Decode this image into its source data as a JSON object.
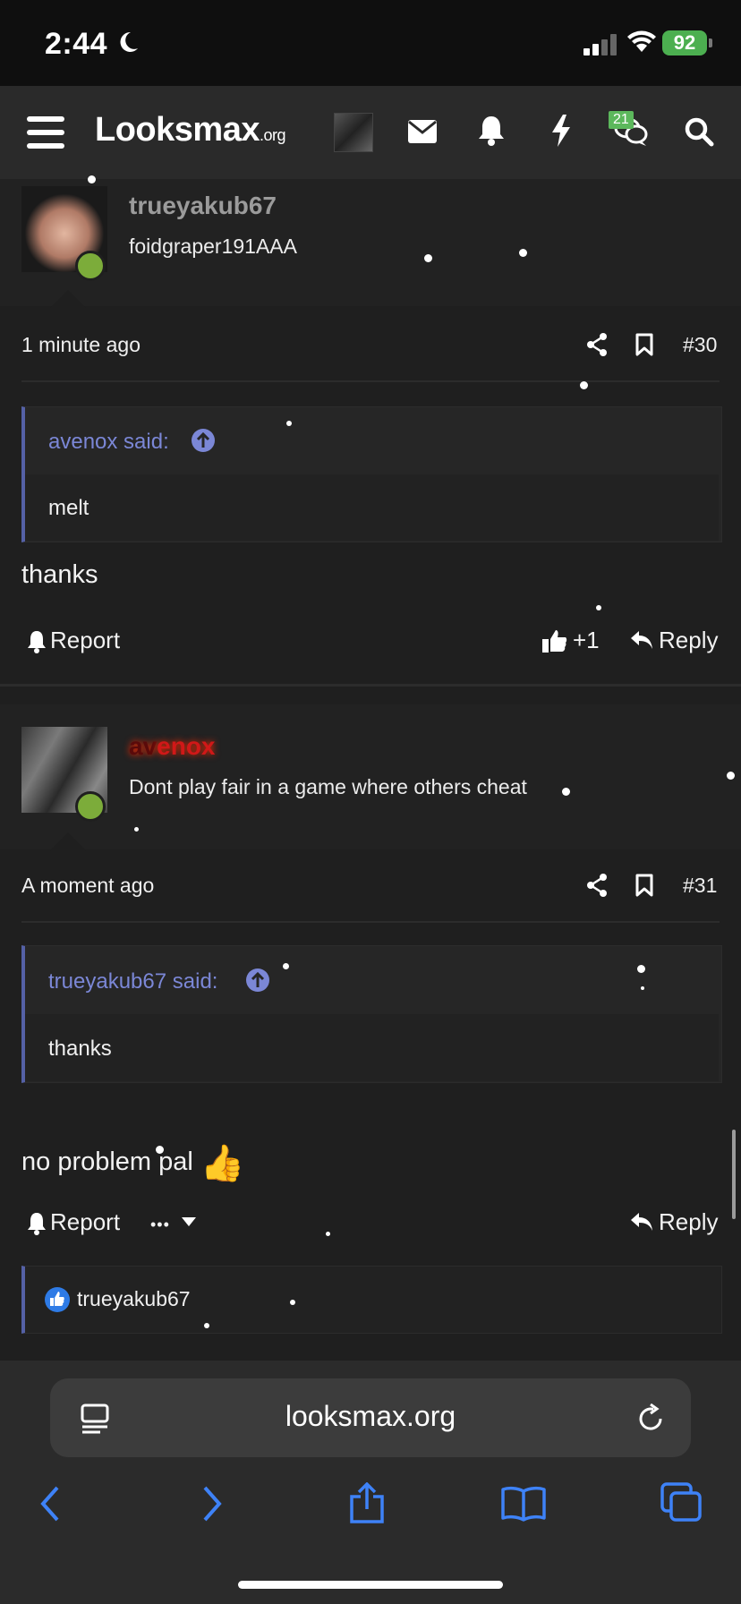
{
  "status": {
    "time": "2:44",
    "battery": "92"
  },
  "header": {
    "logo_main": "Looksmax",
    "logo_suffix": ".org",
    "chat_badge": "21"
  },
  "posts": [
    {
      "username": "trueyakub67",
      "user_title": "foidgraper191AAA",
      "time": "1 minute ago",
      "number": "#30",
      "quote_author": "avenox said:",
      "quote_text": "melt",
      "text": "thanks",
      "report_label": "Report",
      "like_count": "+1",
      "reply_label": "Reply"
    },
    {
      "username_part1": "av",
      "username_part2": "enox",
      "user_title": "Dont play fair in a game where others cheat",
      "time": "A moment ago",
      "number": "#31",
      "quote_author": "trueyakub67 said:",
      "quote_text": "thanks",
      "text": "no problem pal",
      "emoji": "👍",
      "report_label": "Report",
      "more_label": "•••",
      "reply_label": "Reply",
      "reaction_user": "trueyakub67"
    }
  ],
  "browser": {
    "url": "looksmax.org"
  }
}
